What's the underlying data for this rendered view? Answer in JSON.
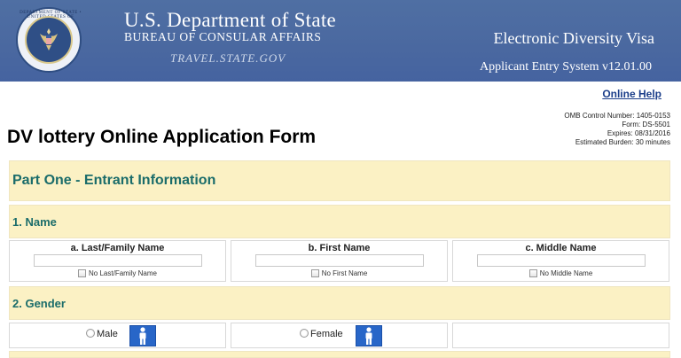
{
  "header": {
    "department": "U.S. Department of State",
    "bureau": "BUREAU OF CONSULAR AFFAIRS",
    "site": "TRAVEL.STATE.GOV",
    "program": "Electronic Diversity Visa",
    "system": "Applicant Entry System  v12.01.00",
    "seal_text": "DEPARTMENT OF STATE • UNITED STATES OF AMERICA",
    "colors": {
      "banner": "#4a68a0",
      "section_band": "#fbf1c4",
      "section_text": "#1a6c6a",
      "icon_blue": "#2866c8"
    }
  },
  "help_link": "Online Help",
  "omb": {
    "control": "OMB Control Number: 1405-0153",
    "form": "Form: DS-5501",
    "expires": "Expires: 08/31/2016",
    "burden": "Estimated Burden: 30 minutes"
  },
  "page_title": "DV lottery  Online Application Form",
  "part_one": {
    "title": "Part One - Entrant Information",
    "name_section": {
      "title": "1. Name",
      "fields": [
        {
          "label": "a. Last/Family Name",
          "value": "",
          "checkbox": "No Last/Family Name"
        },
        {
          "label": "b. First Name",
          "value": "",
          "checkbox": "No First Name"
        },
        {
          "label": "c. Middle Name",
          "value": "",
          "checkbox": "No Middle Name"
        }
      ]
    },
    "gender_section": {
      "title": "2. Gender",
      "options": [
        {
          "label": "Male",
          "icon": "male-person-icon"
        },
        {
          "label": "Female",
          "icon": "female-person-icon"
        }
      ]
    }
  }
}
